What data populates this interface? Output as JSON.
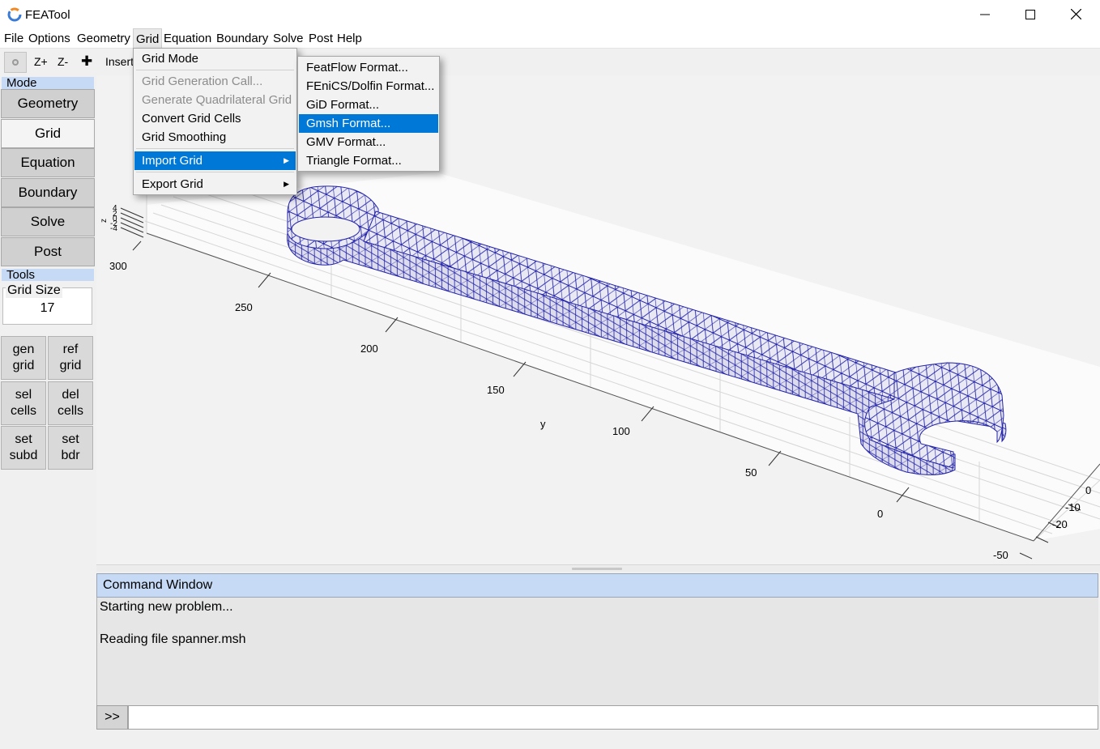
{
  "window": {
    "title": "FEATool"
  },
  "menubar": {
    "items": [
      "File",
      "Options",
      "Geometry",
      "Grid",
      "Equation",
      "Boundary",
      "Solve",
      "Post",
      "Help"
    ],
    "open_menu": "Grid"
  },
  "toolbar": {
    "zplus": "Z+",
    "zminus": "Z-",
    "insert": "Insert"
  },
  "left_panel": {
    "mode_label": "Mode",
    "modes": [
      "Geometry",
      "Grid",
      "Equation",
      "Boundary",
      "Solve",
      "Post"
    ],
    "active_mode": "Grid",
    "tools_label": "Tools",
    "grid_size_label": "Grid Size",
    "grid_size_value": "17",
    "tool_buttons": [
      {
        "line1": "gen",
        "line2": "grid"
      },
      {
        "line1": "ref",
        "line2": "grid"
      },
      {
        "line1": "sel",
        "line2": "cells"
      },
      {
        "line1": "del",
        "line2": "cells"
      },
      {
        "line1": "set",
        "line2": "subd"
      },
      {
        "line1": "set",
        "line2": "bdr"
      }
    ]
  },
  "grid_menu": {
    "items": [
      {
        "label": "Grid Mode",
        "enabled": true
      },
      {
        "label": "Grid Generation Call...",
        "enabled": false
      },
      {
        "label": "Generate Quadrilateral Grid",
        "enabled": false
      },
      {
        "label": "Convert Grid Cells",
        "enabled": true
      },
      {
        "label": "Grid Smoothing",
        "enabled": true
      },
      {
        "label": "Import Grid",
        "enabled": true,
        "submenu": true,
        "highlighted": true
      },
      {
        "label": "Export Grid",
        "enabled": true,
        "submenu": true
      }
    ]
  },
  "import_submenu": {
    "items": [
      "FeatFlow Format...",
      "FEniCS/Dolfin Format...",
      "GiD Format...",
      "Gmsh Format...",
      "GMV Format...",
      "Triangle Format..."
    ],
    "highlighted": "Gmsh Format..."
  },
  "plot": {
    "y_axis_label": "y",
    "z_axis_label": "z",
    "y_ticks": [
      "300",
      "250",
      "200",
      "150",
      "100",
      "50",
      "0"
    ],
    "x_ticks": [
      "0",
      "-10",
      "-20",
      "-50"
    ],
    "z_ticks": [
      "4",
      "2",
      "0",
      "-2",
      "-4"
    ],
    "mesh_color": "#2222aa"
  },
  "command_window": {
    "title": "Command Window",
    "lines": [
      "Starting new problem...",
      "",
      "Reading file spanner.msh"
    ],
    "prompt": ">>",
    "input_value": ""
  },
  "colors": {
    "menu_highlight": "#0078d7",
    "section_header": "#c6daf6"
  }
}
